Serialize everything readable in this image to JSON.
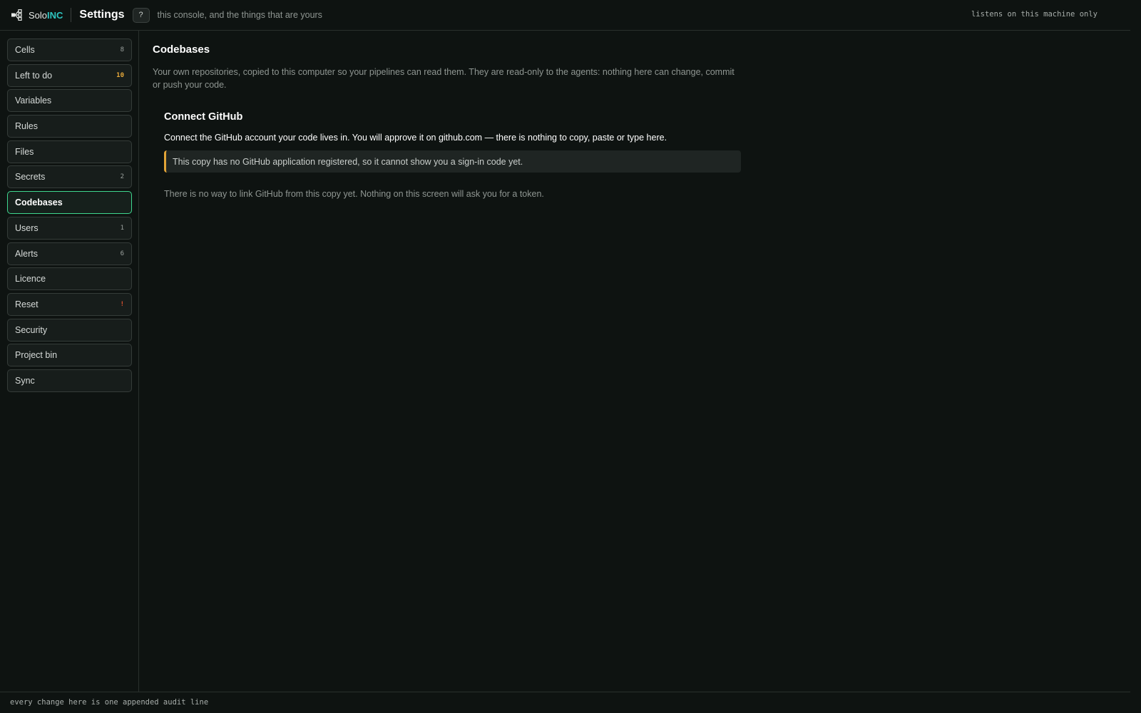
{
  "header": {
    "logo_icon": "logo-icon",
    "brand_prefix": "Solo",
    "brand_suffix": "INC",
    "title": "Settings",
    "help_label": "?",
    "tagline": "this console, and the things that are yours",
    "status": "listens on this machine only"
  },
  "sidebar": {
    "items": [
      {
        "label": "Cells",
        "count": "8"
      },
      {
        "label": "Left to do",
        "count": "10"
      },
      {
        "label": "Variables",
        "count": ""
      },
      {
        "label": "Rules",
        "count": ""
      },
      {
        "label": "Files",
        "count": ""
      },
      {
        "label": "Secrets",
        "count": "2"
      },
      {
        "label": "Codebases",
        "count": ""
      },
      {
        "label": "Users",
        "count": "1"
      },
      {
        "label": "Alerts",
        "count": "6"
      },
      {
        "label": "Licence",
        "count": ""
      },
      {
        "label": "Reset",
        "count": "!"
      },
      {
        "label": "Security",
        "count": ""
      },
      {
        "label": "Project bin",
        "count": ""
      },
      {
        "label": "Sync",
        "count": ""
      }
    ]
  },
  "main": {
    "title": "Codebases",
    "description": "Your own repositories, copied to this computer so your pipelines can read them. They are read-only to the agents: nothing here can change, commit or push your code.",
    "card": {
      "title": "Connect GitHub",
      "text": "Connect the GitHub account your code lives in. You will approve it on github.com — there is nothing to copy, paste or type here.",
      "notice": "This copy has no GitHub application registered, so it cannot show you a sign-in code yet.",
      "note": "There is no way to link GitHub from this copy yet. Nothing on this screen will ask you for a token."
    }
  },
  "footer": {
    "text": "every change here is one appended audit line"
  },
  "colors": {
    "accent_brand": "#2ec5c0",
    "active_border": "#3fd78f",
    "warn": "#e7a93a",
    "danger": "#e2532f"
  }
}
